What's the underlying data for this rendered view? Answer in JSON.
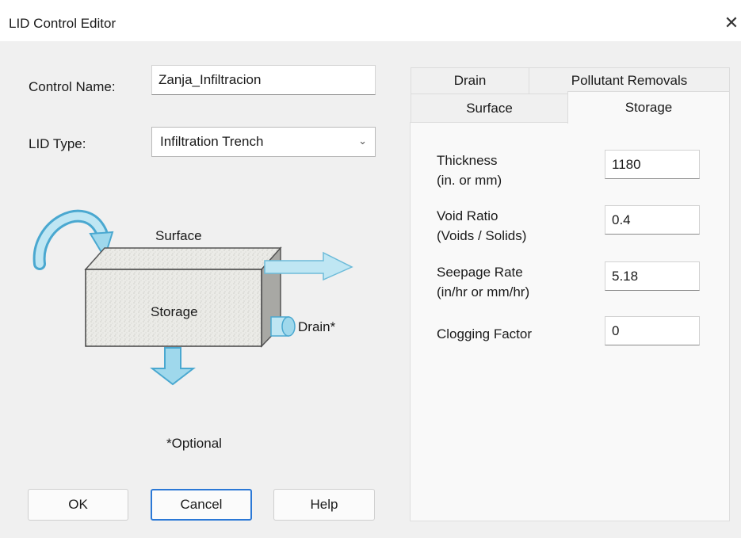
{
  "window": {
    "title": "LID Control Editor",
    "close_glyph": "✕"
  },
  "form": {
    "control_name_label": "Control Name:",
    "control_name_value": "Zanja_Infiltracion",
    "lid_type_label": "LID Type:",
    "lid_type_value": "Infiltration Trench"
  },
  "diagram": {
    "surface_label": "Surface",
    "storage_label": "Storage",
    "drain_label": "Drain*",
    "optional_note": "*Optional"
  },
  "buttons": {
    "ok": "OK",
    "cancel": "Cancel",
    "help": "Help"
  },
  "tabs": {
    "top_row": [
      {
        "label": "Drain"
      },
      {
        "label": "Pollutant Removals"
      }
    ],
    "bottom_row": [
      {
        "label": "Surface"
      },
      {
        "label": "Storage",
        "active": true
      }
    ]
  },
  "storage_fields": [
    {
      "label_line1": "Thickness",
      "label_line2": "(in. or mm)",
      "value": "1180"
    },
    {
      "label_line1": "Void Ratio",
      "label_line2": "(Voids / Solids)",
      "value": "0.4"
    },
    {
      "label_line1": "Seepage Rate",
      "label_line2": "(in/hr or mm/hr)",
      "value": "5.18"
    },
    {
      "label_line1": "Clogging Factor",
      "label_line2": "",
      "value": "0"
    }
  ],
  "colors": {
    "arrow_fill": "#9fd8ec",
    "arrow_stroke": "#4aa8d0",
    "box_fill": "#e8e8e4",
    "default_button_border": "#2b78d6"
  },
  "icons": {
    "close": "close-icon",
    "dropdown": "chevron-down-icon"
  }
}
